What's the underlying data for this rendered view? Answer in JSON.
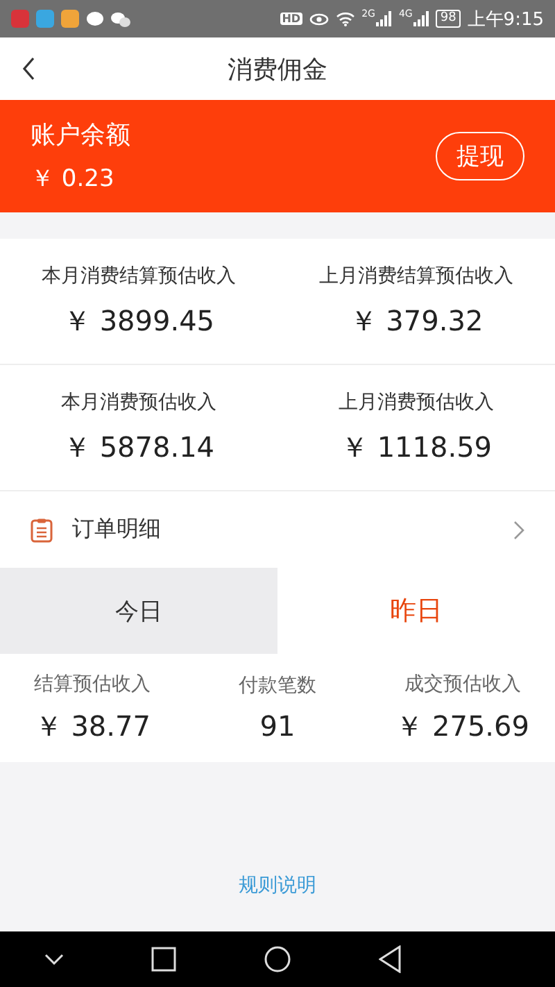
{
  "status_bar": {
    "network_badge": "HD",
    "sim1": "2G",
    "sim2": "4G",
    "battery": "98",
    "time": "上午9:15"
  },
  "header": {
    "title": "消费佣金"
  },
  "balance": {
    "label": "账户余额",
    "amount": "￥ 0.23",
    "button": "提现"
  },
  "stats": [
    {
      "label": "本月消费结算预估收入",
      "value": "￥ 3899.45"
    },
    {
      "label": "上月消费结算预估收入",
      "value": "￥ 379.32"
    },
    {
      "label": "本月消费预估收入",
      "value": "￥ 5878.14"
    },
    {
      "label": "上月消费预估收入",
      "value": "￥ 1118.59"
    }
  ],
  "order_row": {
    "label": "订单明细"
  },
  "tabs": [
    {
      "label": "今日",
      "selected": false
    },
    {
      "label": "昨日",
      "selected": true
    }
  ],
  "summary": [
    {
      "label": "结算预估收入",
      "value": "￥ 38.77"
    },
    {
      "label": "付款笔数",
      "value": "91"
    },
    {
      "label": "成交预估收入",
      "value": "￥ 275.69"
    }
  ],
  "rules_link": "规则说明"
}
